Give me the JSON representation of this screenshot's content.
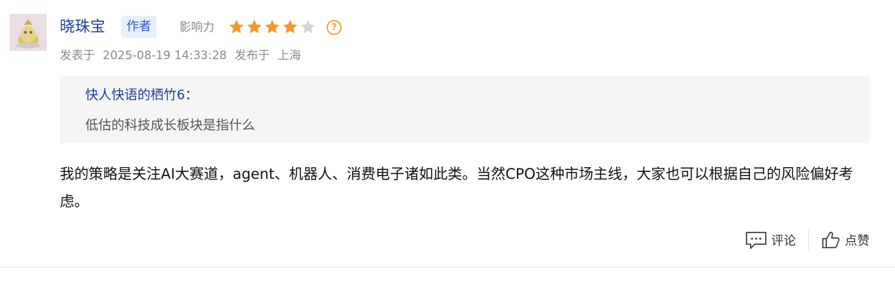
{
  "comment": {
    "author_name": "晓珠宝",
    "author_badge": "作者",
    "influence_label": "影响力",
    "influence_rating": 4,
    "influence_max": 5,
    "help_icon": "?",
    "meta": {
      "posted_prefix": "发表于",
      "posted_time": "2025-08-19 14:33:28",
      "location_prefix": "发布于",
      "location": "上海"
    },
    "quote": {
      "user": "快人快语的栖竹6",
      "colon": "：",
      "text": "低估的科技成长板块是指什么"
    },
    "content": "我的策略是关注AI大赛道，agent、机器人、消费电子诸如此类。当然CPO这种市场主线，大家也可以根据自己的风险偏好考虑。",
    "actions": {
      "reply_label": "评论",
      "like_label": "点赞"
    }
  },
  "colors": {
    "star_filled": "#f39a2c",
    "star_empty": "#d6d6d6",
    "author_link": "#1f3f95"
  }
}
